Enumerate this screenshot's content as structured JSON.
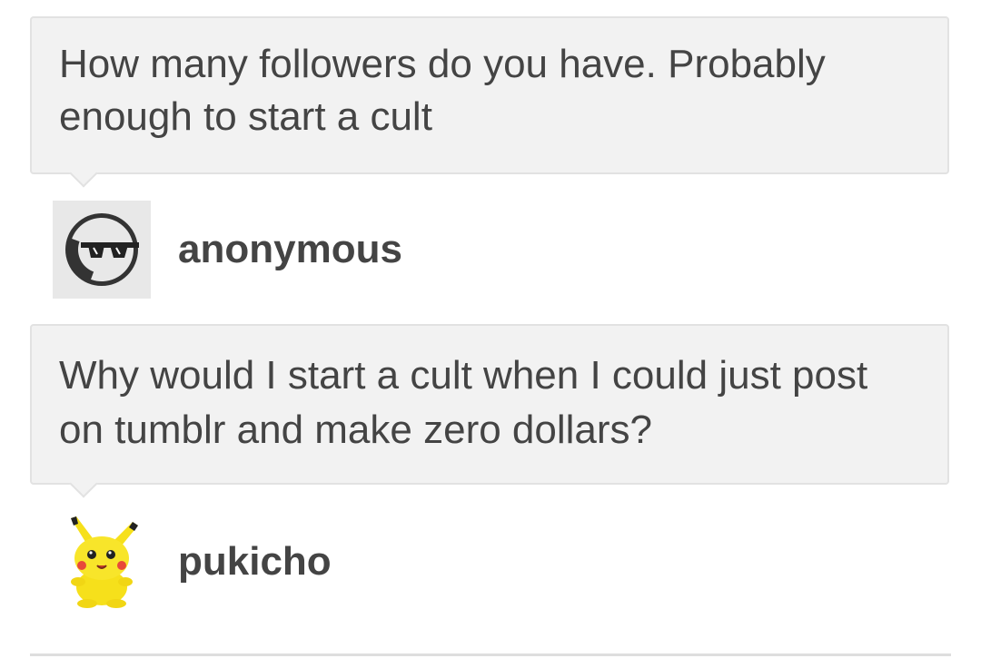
{
  "question": {
    "text": "How many followers do you have. Probably enough to start a cult",
    "asker": {
      "name": "anonymous",
      "avatar_icon": "anonymous-sunglasses-icon"
    }
  },
  "answer": {
    "text": "Why would I start a cult when I could just post on tumblr and make zero dollars?",
    "author": {
      "name": "pukicho",
      "avatar_icon": "pikachu-plush-icon"
    }
  },
  "colors": {
    "bubble_bg": "#f2f2f2",
    "bubble_border": "#e2e2e2",
    "text": "#444444",
    "pikachu_yellow": "#f6e01b"
  }
}
